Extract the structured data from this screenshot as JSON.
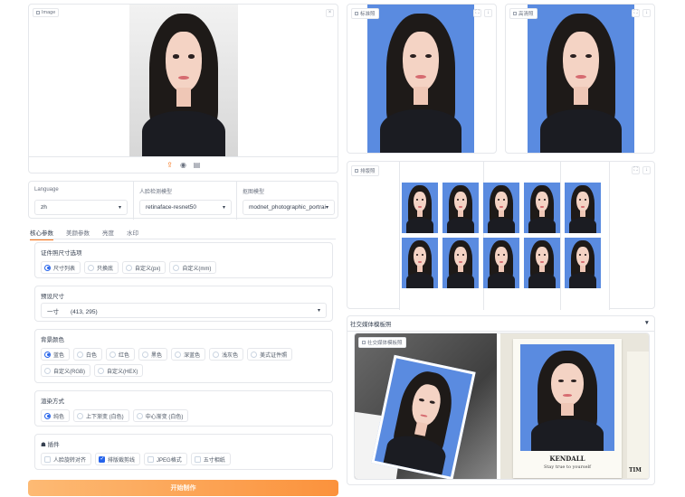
{
  "image_panel": {
    "tag": "Image",
    "close": "×"
  },
  "toolbar": {
    "upload_icon": "upload-icon",
    "webcam_icon": "webcam-icon",
    "clipboard_icon": "clipboard-icon"
  },
  "language": {
    "label": "Language",
    "value": "zh"
  },
  "face_model": {
    "label": "人脸检测模型",
    "value": "retinaface-resnet50"
  },
  "matting_model": {
    "label": "抠图模型",
    "value": "modnet_photographic_portrait"
  },
  "tabs": [
    {
      "label": "核心参数",
      "active": true
    },
    {
      "label": "美颜参数",
      "active": false
    },
    {
      "label": "亮度",
      "active": false
    },
    {
      "label": "水印",
      "active": false
    }
  ],
  "size_mode": {
    "label": "证件照尺寸选项",
    "options": [
      {
        "label": "尺寸列表",
        "selected": true
      },
      {
        "label": "只换底",
        "selected": false
      },
      {
        "label": "自定义(px)",
        "selected": false
      },
      {
        "label": "自定义(mm)",
        "selected": false
      }
    ]
  },
  "preset_size": {
    "label": "预设尺寸",
    "value": "一寸　　(413, 295)"
  },
  "bg_color": {
    "label": "背景颜色",
    "options": [
      {
        "label": "蓝色",
        "selected": true
      },
      {
        "label": "白色",
        "selected": false
      },
      {
        "label": "红色",
        "selected": false
      },
      {
        "label": "黑色",
        "selected": false
      },
      {
        "label": "深蓝色",
        "selected": false
      },
      {
        "label": "浅灰色",
        "selected": false
      },
      {
        "label": "美式证件照",
        "selected": false
      },
      {
        "label": "自定义(RGB)",
        "selected": false
      },
      {
        "label": "自定义(HEX)",
        "selected": false
      }
    ]
  },
  "render_mode": {
    "label": "渲染方式",
    "options": [
      {
        "label": "纯色",
        "selected": true
      },
      {
        "label": "上下渐变 (白色)",
        "selected": false
      },
      {
        "label": "中心渐变 (白色)",
        "selected": false
      }
    ]
  },
  "plugins": {
    "label": "插件",
    "options": [
      {
        "label": "人脸旋转对齐",
        "checked": false
      },
      {
        "label": "排版裁剪线",
        "checked": true
      },
      {
        "label": "JPEG格式",
        "checked": false
      },
      {
        "label": "五寸相纸",
        "checked": false
      }
    ]
  },
  "start_button": "开始制作",
  "standard_panel": {
    "tag": "标准照"
  },
  "hd_panel": {
    "tag": "高清照"
  },
  "layout_panel": {
    "tag": "排版照"
  },
  "social": {
    "accordion": "社交媒体模板照",
    "tag": "社交媒体模板照",
    "caret": "▼",
    "card_name": "KENDALL",
    "card_caption": "Stay true to yourself",
    "card_side": "TIM"
  },
  "colors": {
    "accent": "#f97316",
    "photo_blue": "#5a8be0",
    "radio_blue": "#2563eb"
  }
}
